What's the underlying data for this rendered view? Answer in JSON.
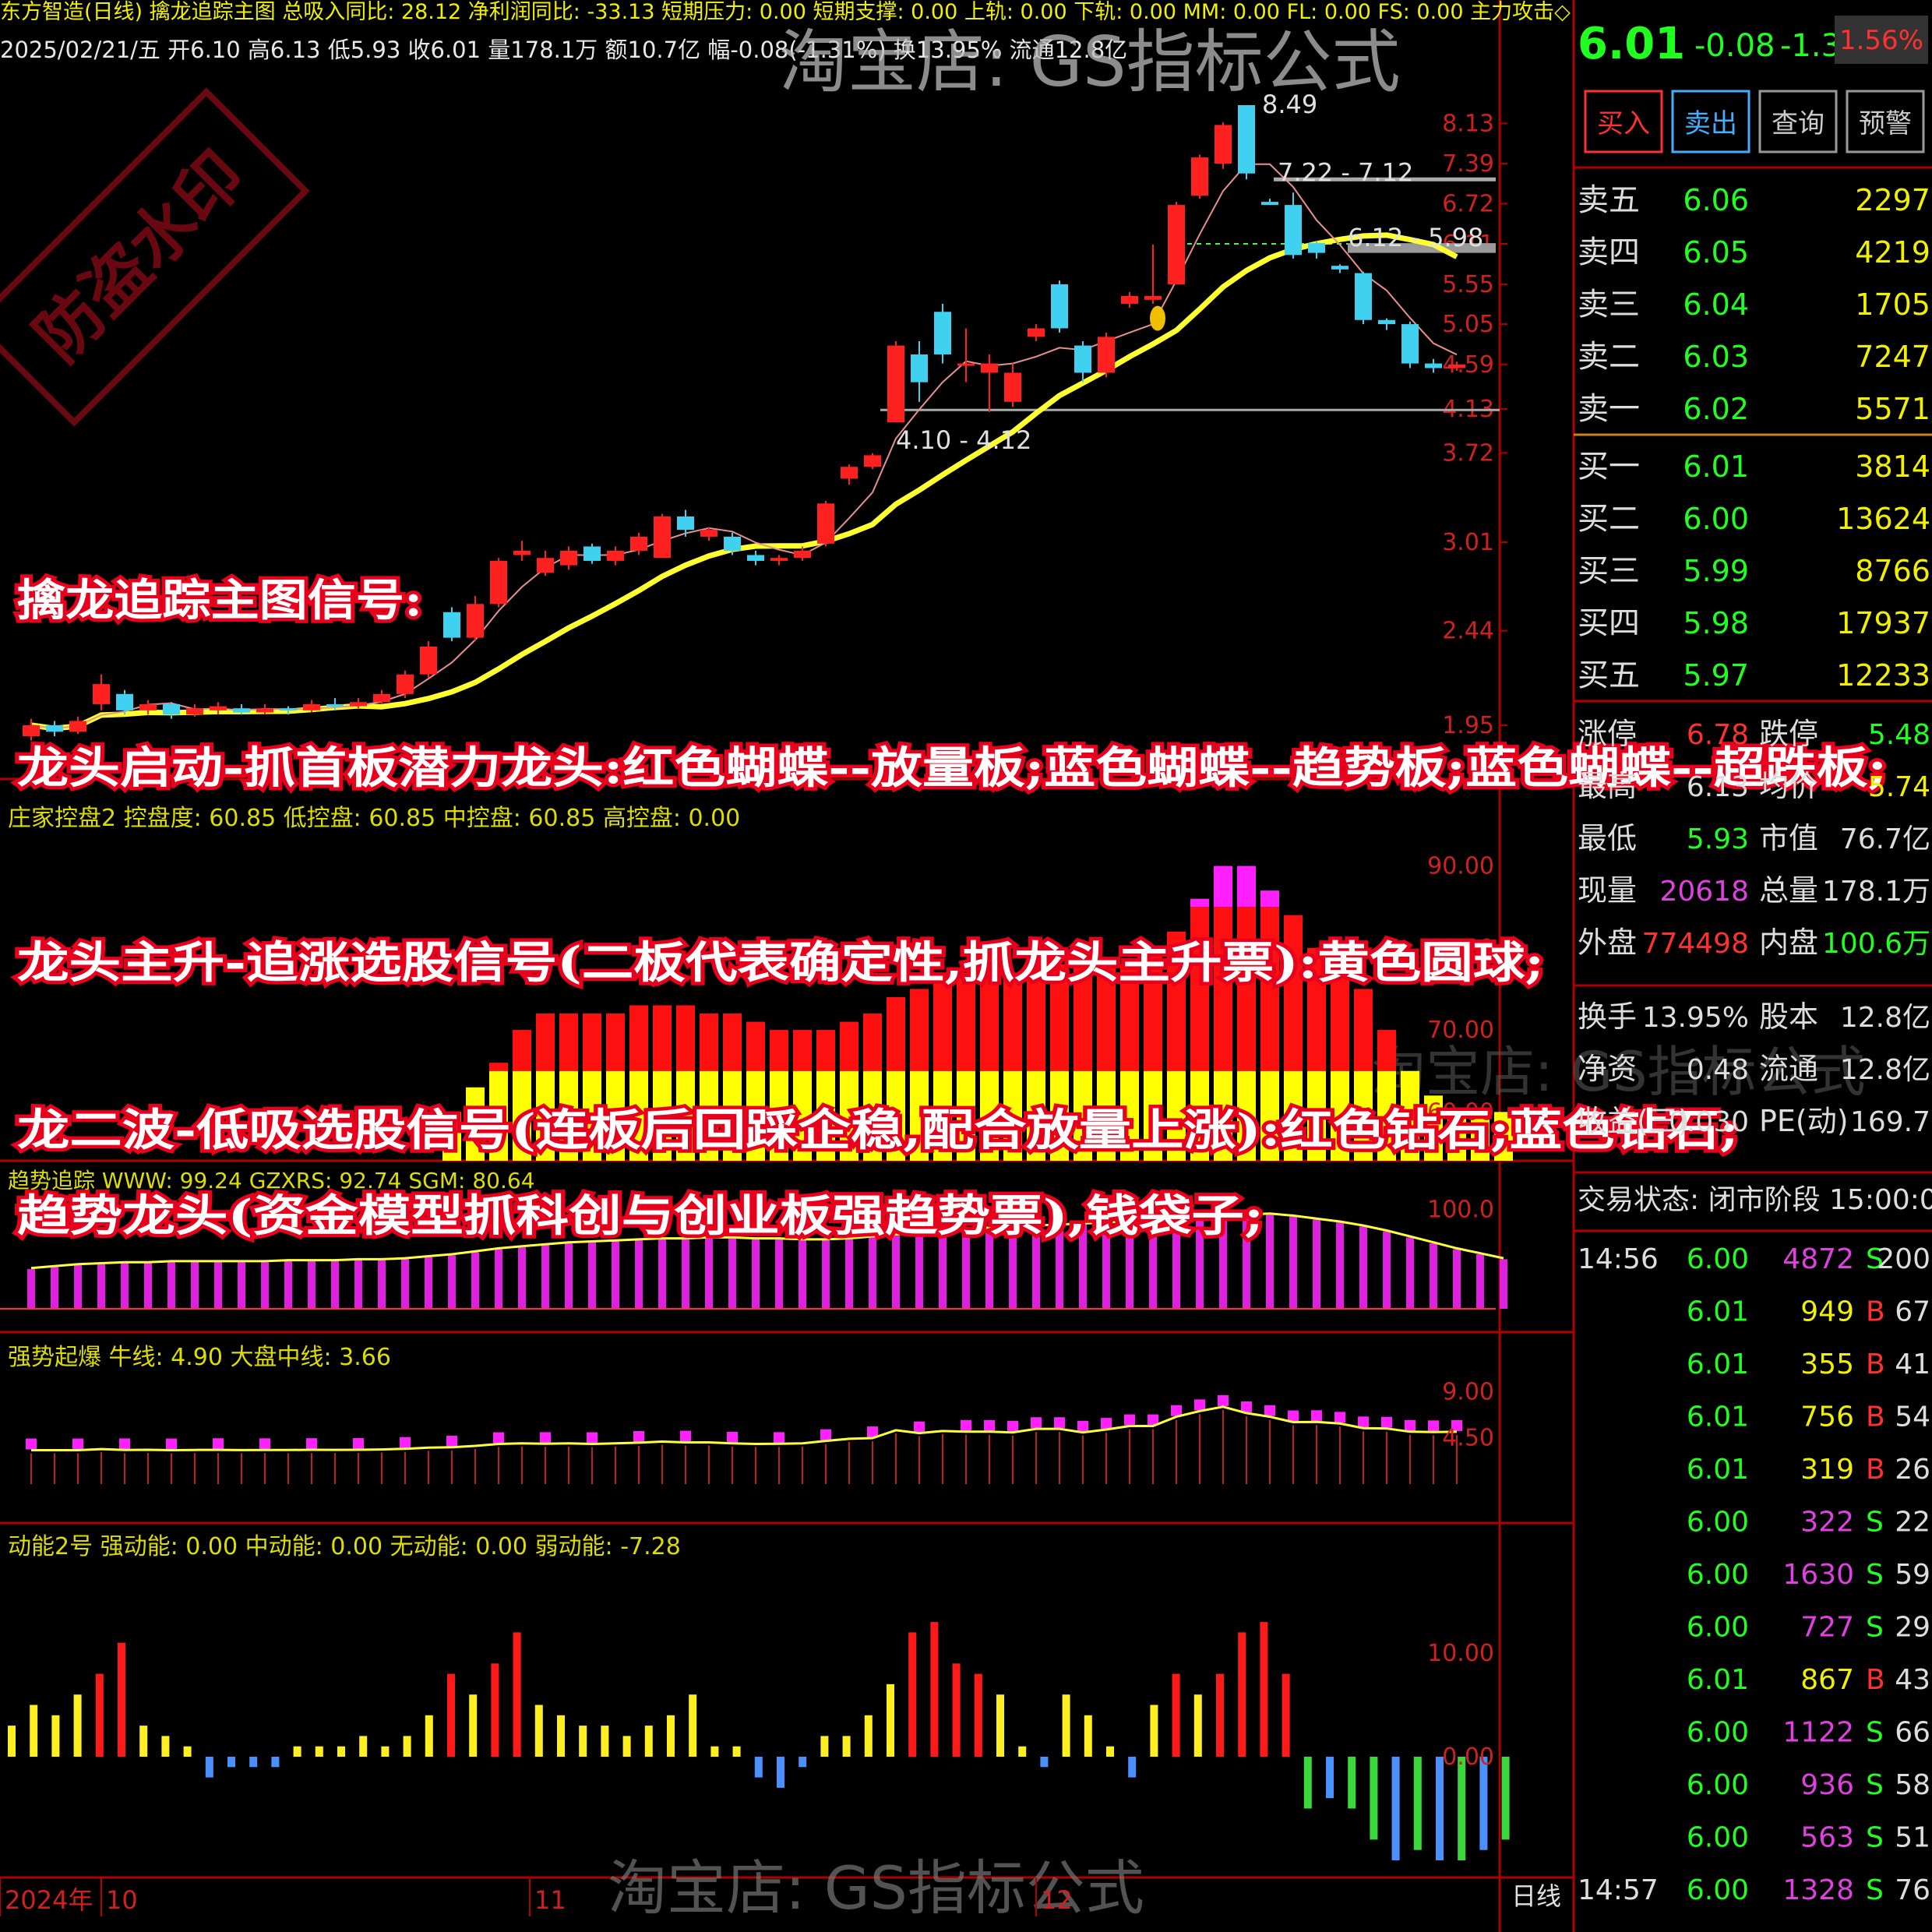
{
  "header": {
    "title_line": "东方智造(日线)  擒龙追踪主图 总吸入同比: 28.12 净利润同比: -33.13 短期压力: 0.00 短期支撑: 0.00 上轨: 0.00 下轨: 0.00 MM: 0.00 FL: 0.00 FS: 0.00 主力攻击◇",
    "quote_line": "2025/02/21/五 开6.10 高6.13 低5.93 收6.01 量178.1万 额10.7亿 幅-0.08(-1.31%) 换13.95% 流通12.8亿",
    "watermark": "淘宝店: GS指标公式",
    "stamp": "防盗水印"
  },
  "main_chart": {
    "y_ticks": [
      "8.13",
      "7.39",
      "6.72",
      "6.11",
      "5.55",
      "5.05",
      "4.59",
      "4.13",
      "3.72",
      "3.01",
      "2.44",
      "1.95"
    ],
    "annotations": [
      "8.49",
      "7.22 - 7.12",
      "6.12 - 5.98",
      "4.10 - 4.12"
    ],
    "candles": [
      {
        "o": 1.9,
        "c": 1.95,
        "h": 1.98,
        "l": 1.88
      },
      {
        "o": 1.95,
        "c": 1.92,
        "h": 1.97,
        "l": 1.9
      },
      {
        "o": 1.92,
        "c": 1.97,
        "h": 1.99,
        "l": 1.91
      },
      {
        "o": 2.05,
        "c": 2.15,
        "h": 2.2,
        "l": 2.02
      },
      {
        "o": 2.1,
        "c": 2.02,
        "h": 2.12,
        "l": 2.0
      },
      {
        "o": 2.02,
        "c": 2.05,
        "h": 2.07,
        "l": 2.0
      },
      {
        "o": 2.05,
        "c": 2.0,
        "h": 2.06,
        "l": 1.98
      },
      {
        "o": 2.0,
        "c": 2.03,
        "h": 2.05,
        "l": 1.99
      },
      {
        "o": 2.02,
        "c": 2.04,
        "h": 2.06,
        "l": 2.0
      },
      {
        "o": 2.03,
        "c": 2.01,
        "h": 2.05,
        "l": 2.0
      },
      {
        "o": 2.01,
        "c": 2.03,
        "h": 2.05,
        "l": 2.0
      },
      {
        "o": 2.03,
        "c": 2.02,
        "h": 2.04,
        "l": 2.0
      },
      {
        "o": 2.02,
        "c": 2.05,
        "h": 2.07,
        "l": 2.01
      },
      {
        "o": 2.05,
        "c": 2.04,
        "h": 2.08,
        "l": 2.02
      },
      {
        "o": 2.04,
        "c": 2.06,
        "h": 2.08,
        "l": 2.03
      },
      {
        "o": 2.06,
        "c": 2.1,
        "h": 2.12,
        "l": 2.05
      },
      {
        "o": 2.1,
        "c": 2.2,
        "h": 2.22,
        "l": 2.08
      },
      {
        "o": 2.2,
        "c": 2.35,
        "h": 2.38,
        "l": 2.18
      },
      {
        "o": 2.55,
        "c": 2.4,
        "h": 2.58,
        "l": 2.38
      },
      {
        "o": 2.4,
        "c": 2.6,
        "h": 2.65,
        "l": 2.38
      },
      {
        "o": 2.6,
        "c": 2.88,
        "h": 2.9,
        "l": 2.58
      },
      {
        "o": 2.92,
        "c": 2.95,
        "h": 3.02,
        "l": 2.88
      },
      {
        "o": 2.8,
        "c": 2.9,
        "h": 2.95,
        "l": 2.78
      },
      {
        "o": 2.85,
        "c": 2.95,
        "h": 2.98,
        "l": 2.82
      },
      {
        "o": 2.98,
        "c": 2.88,
        "h": 3.0,
        "l": 2.86
      },
      {
        "o": 2.88,
        "c": 2.95,
        "h": 2.98,
        "l": 2.85
      },
      {
        "o": 2.95,
        "c": 3.05,
        "h": 3.08,
        "l": 2.92
      },
      {
        "o": 2.9,
        "c": 3.2,
        "h": 3.22,
        "l": 2.9
      },
      {
        "o": 3.2,
        "c": 3.1,
        "h": 3.25,
        "l": 3.05
      },
      {
        "o": 3.05,
        "c": 3.1,
        "h": 3.12,
        "l": 3.02
      },
      {
        "o": 3.05,
        "c": 2.95,
        "h": 3.08,
        "l": 2.92
      },
      {
        "o": 2.92,
        "c": 2.88,
        "h": 2.95,
        "l": 2.85
      },
      {
        "o": 2.88,
        "c": 2.9,
        "h": 2.92,
        "l": 2.85
      },
      {
        "o": 2.9,
        "c": 2.95,
        "h": 2.98,
        "l": 2.88
      },
      {
        "o": 3.0,
        "c": 3.3,
        "h": 3.32,
        "l": 2.98
      },
      {
        "o": 3.5,
        "c": 3.6,
        "h": 3.62,
        "l": 3.45
      },
      {
        "o": 3.6,
        "c": 3.7,
        "h": 3.72,
        "l": 3.58
      },
      {
        "o": 4.0,
        "c": 4.8,
        "h": 4.85,
        "l": 4.0
      },
      {
        "o": 4.7,
        "c": 4.4,
        "h": 4.85,
        "l": 4.2
      },
      {
        "o": 5.2,
        "c": 4.7,
        "h": 5.3,
        "l": 4.6
      },
      {
        "o": 4.6,
        "c": 4.6,
        "h": 5.0,
        "l": 4.4
      },
      {
        "o": 4.5,
        "c": 4.6,
        "h": 4.7,
        "l": 4.1
      },
      {
        "o": 4.2,
        "c": 4.5,
        "h": 4.6,
        "l": 4.15
      },
      {
        "o": 4.9,
        "c": 5.0,
        "h": 5.05,
        "l": 4.85
      },
      {
        "o": 5.55,
        "c": 5.0,
        "h": 5.6,
        "l": 4.95
      },
      {
        "o": 4.8,
        "c": 4.5,
        "h": 4.85,
        "l": 4.4
      },
      {
        "o": 4.5,
        "c": 4.9,
        "h": 4.95,
        "l": 4.45
      },
      {
        "o": 5.3,
        "c": 5.4,
        "h": 5.45,
        "l": 5.25
      },
      {
        "o": 5.35,
        "c": 5.4,
        "h": 6.1,
        "l": 5.3
      },
      {
        "o": 5.55,
        "c": 6.7,
        "h": 6.75,
        "l": 5.55
      },
      {
        "o": 6.85,
        "c": 7.5,
        "h": 7.55,
        "l": 6.8
      },
      {
        "o": 7.39,
        "c": 8.1,
        "h": 8.15,
        "l": 7.3
      },
      {
        "o": 8.49,
        "c": 7.22,
        "h": 8.49,
        "l": 7.12
      },
      {
        "o": 6.75,
        "c": 6.7,
        "h": 6.8,
        "l": 6.7
      },
      {
        "o": 6.7,
        "c": 5.95,
        "h": 6.9,
        "l": 5.9
      },
      {
        "o": 6.12,
        "c": 5.98,
        "h": 6.15,
        "l": 5.9
      },
      {
        "o": 5.8,
        "c": 5.75,
        "h": 5.82,
        "l": 5.7
      },
      {
        "o": 5.7,
        "c": 5.1,
        "h": 5.72,
        "l": 5.05
      },
      {
        "o": 5.1,
        "c": 5.05,
        "h": 5.12,
        "l": 4.98
      },
      {
        "o": 5.05,
        "c": 4.6,
        "h": 5.08,
        "l": 4.55
      },
      {
        "o": 4.6,
        "c": 4.55,
        "h": 4.65,
        "l": 4.5
      },
      {
        "o": 4.55,
        "c": 4.59,
        "h": 4.62,
        "l": 4.52
      }
    ]
  },
  "promo": [
    "擒龙追踪主图信号:",
    "龙头启动-抓首板潜力龙头:红色蝴蝶--放量板;蓝色蝴蝶--趋势板;蓝色蝴蝶--超跌板;",
    "龙头主升-追涨选股信号(二板代表确定性,抓龙头主升票):黄色圆球;",
    "龙二波-低吸选股信号(连板后回踩企稳,配合放量上涨):红色钻石;蓝色钻石;",
    "趋势龙头(资金模型抓科创与创业板强趋势票),钱袋子;"
  ],
  "panel_control": {
    "header": "庄家控盘2 控盘度: 60.85  低控盘: 60.85  中控盘: 60.85  高控盘: 0.00",
    "y_ticks": [
      "90.00",
      "80.00",
      "70.00",
      "60.00"
    ],
    "values": [
      0,
      0,
      0,
      0,
      0,
      0,
      0,
      0,
      0,
      0,
      0,
      0,
      0,
      0,
      0,
      0,
      0,
      0,
      60,
      63,
      66,
      70,
      72,
      72,
      72,
      72,
      73,
      73,
      73,
      72,
      72,
      71,
      70,
      70,
      70,
      71,
      72,
      74,
      75,
      76,
      77,
      77,
      77,
      77,
      78,
      78,
      78,
      78,
      80,
      82,
      86,
      90,
      90,
      87,
      84,
      80,
      78,
      75,
      70,
      65,
      62,
      60,
      60,
      60
    ],
    "threshold": 65
  },
  "panel_trend": {
    "header": "趋势追踪 WWW: 99.24  GZXRS: 92.74  SGM: 80.64",
    "y_ticks": [
      "100.0"
    ],
    "values": [
      40,
      42,
      44,
      45,
      46,
      46,
      47,
      47,
      47,
      47,
      47,
      48,
      48,
      48,
      49,
      49,
      50,
      52,
      54,
      57,
      60,
      62,
      64,
      66,
      67,
      68,
      69,
      70,
      70,
      71,
      71,
      70,
      70,
      69,
      69,
      70,
      72,
      74,
      76,
      78,
      80,
      81,
      82,
      83,
      84,
      85,
      86,
      87,
      88,
      89,
      90,
      92,
      94,
      95,
      93,
      90,
      87,
      83,
      78,
      72,
      66,
      60,
      55,
      50
    ]
  },
  "panel_strong": {
    "header": "强势起爆 牛线: 4.90 大盘中线: 3.66",
    "y_ticks": [
      "9.00",
      "4.50"
    ]
  },
  "panel_momentum": {
    "header": "动能2号  强动能: 0.00  中动能: 0.00  无动能: 0.00  弱动能: -7.28",
    "y_ticks": [
      "10.00",
      "0.00"
    ],
    "values": [
      3,
      5,
      4,
      6,
      8,
      11,
      3,
      2,
      1,
      -2,
      -1,
      -1,
      -1,
      1,
      1,
      1,
      2,
      1,
      2,
      4,
      8,
      6,
      9,
      12,
      5,
      4,
      3,
      3,
      2,
      3,
      4,
      6,
      1,
      1,
      -2,
      -3,
      -1,
      2,
      2,
      4,
      7,
      12,
      13,
      9,
      8,
      6,
      1,
      -1,
      6,
      4,
      1,
      -2,
      5,
      8,
      6,
      8,
      12,
      13,
      8,
      -5,
      -4,
      -5,
      -8,
      -10,
      -9,
      -10,
      -10,
      -9,
      -8
    ]
  },
  "x_axis": {
    "labels": [
      "2024年",
      "10",
      "11",
      "12"
    ],
    "period": "日线"
  },
  "right_panel": {
    "price": "6.01",
    "change": "-0.08",
    "pct": "-1.31%",
    "badge": "1.56%",
    "buttons": [
      "买入",
      "卖出",
      "查询",
      "预警"
    ],
    "asks": [
      {
        "label": "卖五",
        "price": "6.06",
        "vol": "2297"
      },
      {
        "label": "卖四",
        "price": "6.05",
        "vol": "4219"
      },
      {
        "label": "卖三",
        "price": "6.04",
        "vol": "1705"
      },
      {
        "label": "卖二",
        "price": "6.03",
        "vol": "7247"
      },
      {
        "label": "卖一",
        "price": "6.02",
        "vol": "5571"
      }
    ],
    "bids": [
      {
        "label": "买一",
        "price": "6.01",
        "vol": "3814"
      },
      {
        "label": "买二",
        "price": "6.00",
        "vol": "13624"
      },
      {
        "label": "买三",
        "price": "5.99",
        "vol": "8766"
      },
      {
        "label": "买四",
        "price": "5.98",
        "vol": "17937"
      },
      {
        "label": "买五",
        "price": "5.97",
        "vol": "12233"
      }
    ],
    "stats": [
      {
        "k1": "涨停",
        "v1": "6.78",
        "k2": "跌停",
        "v2": "5.48"
      },
      {
        "k1": "最高",
        "v1": "6.13",
        "k2": "均价",
        "v2": "5.74"
      },
      {
        "k1": "最低",
        "v1": "5.93",
        "k2": "市值",
        "v2": "76.7亿"
      },
      {
        "k1": "现量",
        "v1": "20618",
        "k2": "总量",
        "v2": "178.1万"
      },
      {
        "k1": "外盘",
        "v1": "774498",
        "k2": "内盘",
        "v2": "100.6万"
      }
    ],
    "stats2": [
      {
        "k1": "换手",
        "v1": "13.95%",
        "k2": "股本",
        "v2": "12.8亿"
      },
      {
        "k1": "净资",
        "v1": "0.48",
        "k2": "流通",
        "v2": "12.8亿"
      },
      {
        "k1": "收益(三)",
        "v1": "0.030",
        "k2": "PE(动)",
        "v2": "169.7"
      }
    ],
    "status": "交易状态: 闭市阶段 15:00:00",
    "ticks": [
      {
        "time": "14:56",
        "price": "6.00",
        "vol": "4872",
        "bs": "S",
        "n": "200"
      },
      {
        "time": "",
        "price": "6.01",
        "vol": "949",
        "bs": "B",
        "n": "67"
      },
      {
        "time": "",
        "price": "6.01",
        "vol": "355",
        "bs": "B",
        "n": "41"
      },
      {
        "time": "",
        "price": "6.01",
        "vol": "756",
        "bs": "B",
        "n": "54"
      },
      {
        "time": "",
        "price": "6.01",
        "vol": "319",
        "bs": "B",
        "n": "26"
      },
      {
        "time": "",
        "price": "6.00",
        "vol": "322",
        "bs": "S",
        "n": "22"
      },
      {
        "time": "",
        "price": "6.00",
        "vol": "1630",
        "bs": "S",
        "n": "59"
      },
      {
        "time": "",
        "price": "6.00",
        "vol": "727",
        "bs": "S",
        "n": "29"
      },
      {
        "time": "",
        "price": "6.01",
        "vol": "867",
        "bs": "B",
        "n": "43"
      },
      {
        "time": "",
        "price": "6.00",
        "vol": "1122",
        "bs": "S",
        "n": "66"
      },
      {
        "time": "",
        "price": "6.00",
        "vol": "936",
        "bs": "S",
        "n": "58"
      },
      {
        "time": "",
        "price": "6.00",
        "vol": "563",
        "bs": "S",
        "n": "51"
      },
      {
        "time": "14:57",
        "price": "6.00",
        "vol": "1328",
        "bs": "S",
        "n": "76"
      }
    ]
  },
  "colors": {
    "up": "#ff2020",
    "down": "#40d0f0",
    "ma": "#ffff30",
    "frame": "#b00000",
    "magenta": "#ff20ff"
  }
}
